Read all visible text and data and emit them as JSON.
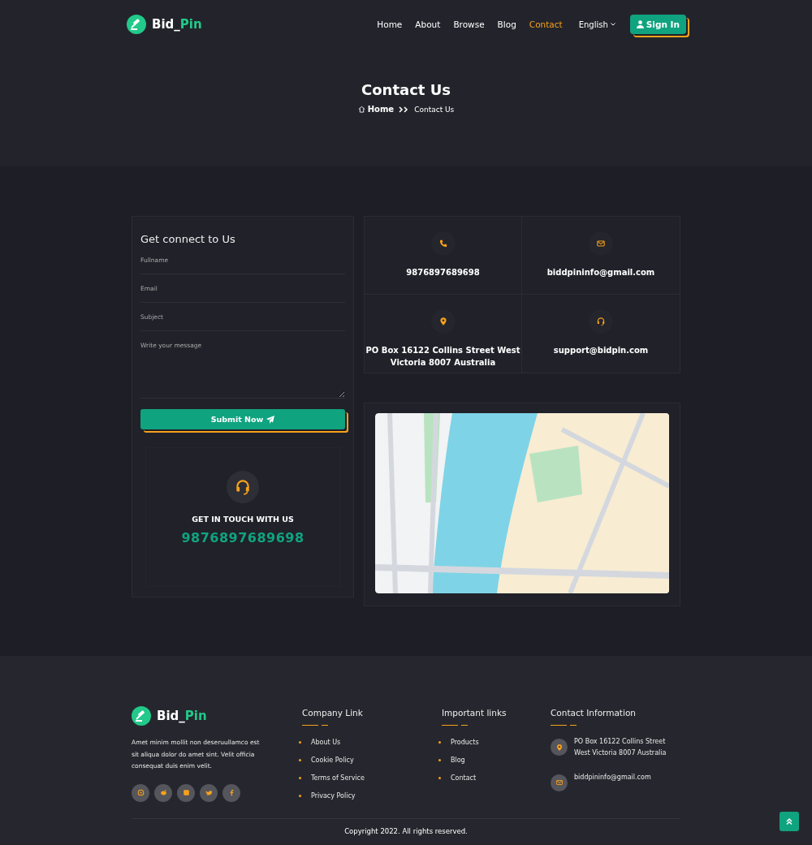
{
  "header": {
    "logo": {
      "part_1": "Bid_",
      "part_2": "Pin"
    },
    "nav": [
      {
        "label": "Home",
        "selected": false
      },
      {
        "label": "About",
        "selected": false
      },
      {
        "label": "Browse",
        "selected": false
      },
      {
        "label": "Blog",
        "selected": false
      },
      {
        "label": "Contact",
        "selected": true
      }
    ],
    "language": "English",
    "sign_in": "Sign In"
  },
  "hero": {
    "title": "Contact Us",
    "breadcrumb": [
      "Home",
      "Contact Us"
    ]
  },
  "form": {
    "title": "Get connect to Us",
    "fields": [
      {
        "placeholder": "Fullname",
        "kind": "line"
      },
      {
        "placeholder": "Email",
        "kind": "line"
      },
      {
        "placeholder": "Subject",
        "kind": "line"
      },
      {
        "placeholder": "Write your message",
        "kind": "area"
      }
    ],
    "submit": "Submit Now"
  },
  "touch": {
    "title": "GET IN TOUCH WITH US",
    "phone": "9876897689698"
  },
  "info_cards": [
    {
      "kind": "phone",
      "lines": [
        "9876897689698"
      ]
    },
    {
      "kind": "mail",
      "lines": [
        "biddpininfo@gmail.com"
      ]
    },
    {
      "kind": "pin",
      "lines": [
        "PO Box 16122 Collins Street West",
        "Victoria 8007 Australia"
      ]
    },
    {
      "kind": "support",
      "lines": [
        "support@bidpin.com"
      ]
    }
  ],
  "footer": {
    "logo": {
      "part_1": "Bid_",
      "part_2": "Pin"
    },
    "about": "Amet minim mollit non deseruullamco est sit aliqua dolor do amet sint. Velit officia consequat duis enim velit.",
    "columns": [
      {
        "title": "Company Link",
        "links": [
          "About Us",
          "Cookie Policy",
          "Terms of Service",
          "Privacy Policy"
        ]
      },
      {
        "title": "Important links",
        "links": [
          "Products",
          "Blog",
          "Contact"
        ]
      }
    ],
    "contact": {
      "title": "Contact Information",
      "items": [
        {
          "kind": "pin",
          "lines": [
            "PO Box 16122 Collins Street",
            "West Victoria 8007 Australia"
          ]
        },
        {
          "kind": "mail",
          "lines": [
            "biddpininfo@gmail.com"
          ]
        }
      ]
    },
    "copyright": "Copyright 2022. All rights reserved."
  }
}
